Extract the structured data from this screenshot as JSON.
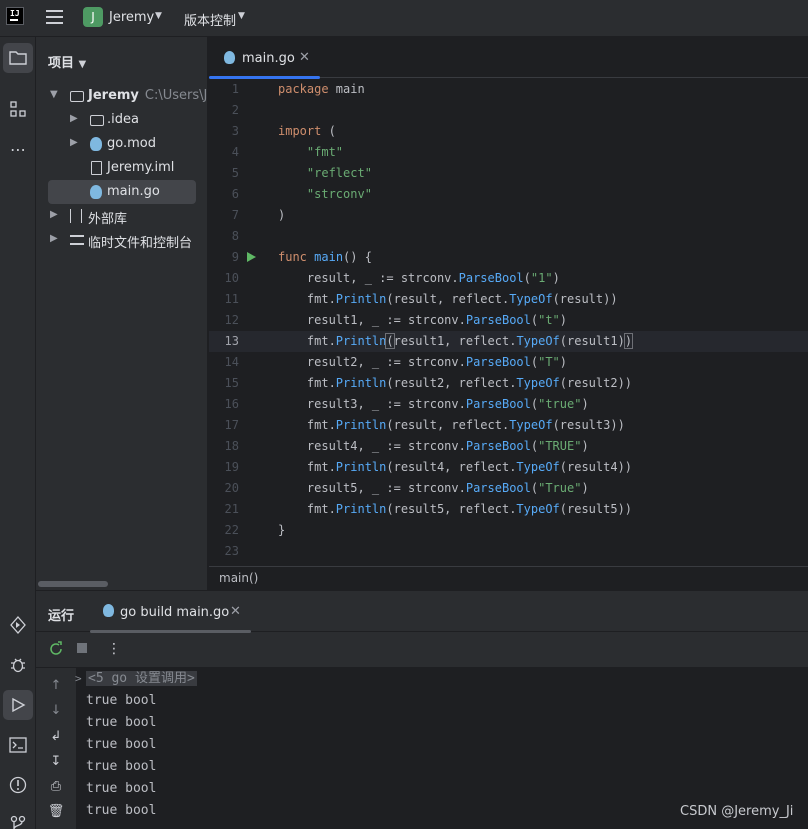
{
  "titlebar": {
    "logo_text": "IJ",
    "project_initial": "J",
    "project_name": "Jeremy",
    "vcs_label": "版本控制"
  },
  "project_panel": {
    "title": "项目",
    "tree": [
      {
        "label": "Jeremy",
        "path": "C:\\Users\\Jer",
        "icon": "folder-icon",
        "expanded": true,
        "depth": 0
      },
      {
        "label": ".idea",
        "icon": "folder-icon",
        "expanded": false,
        "depth": 1
      },
      {
        "label": "go.mod",
        "icon": "go-module-icon",
        "expanded": false,
        "depth": 1
      },
      {
        "label": "Jeremy.iml",
        "icon": "file-icon",
        "depth": 1
      },
      {
        "label": "main.go",
        "icon": "go-file-icon",
        "depth": 1,
        "selected": true
      },
      {
        "label": "外部库",
        "icon": "external-libraries-icon",
        "expanded": false,
        "depth": 0
      },
      {
        "label": "临时文件和控制台",
        "icon": "scratches-icon",
        "expanded": false,
        "depth": 0
      }
    ]
  },
  "editor": {
    "tab_label": "main.go",
    "current_line": 13,
    "lines": [
      {
        "n": "1",
        "html": "<span class=\"kw\">package</span> main"
      },
      {
        "n": "2",
        "html": ""
      },
      {
        "n": "3",
        "html": "<span class=\"kw\">import</span> ("
      },
      {
        "n": "4",
        "html": "    <span class=\"str\">\"fmt\"</span>"
      },
      {
        "n": "5",
        "html": "    <span class=\"str\">\"reflect\"</span>"
      },
      {
        "n": "6",
        "html": "    <span class=\"str\">\"strconv\"</span>"
      },
      {
        "n": "7",
        "html": ")"
      },
      {
        "n": "8",
        "html": ""
      },
      {
        "n": "9",
        "html": "<span class=\"kw\">func</span> <span class=\"fn\">main</span>() {"
      },
      {
        "n": "10",
        "html": "    result, _ := strconv.<span class=\"mcall\">ParseBool</span>(<span class=\"str\">\"1\"</span>)"
      },
      {
        "n": "11",
        "html": "    fmt.<span class=\"mcall\">Println</span>(result, reflect.<span class=\"mcall\">TypeOf</span>(result))"
      },
      {
        "n": "12",
        "html": "    result1, _ := strconv.<span class=\"mcall\">ParseBool</span>(<span class=\"str\">\"t\"</span>)"
      },
      {
        "n": "13",
        "html": "    fmt.<span class=\"mcall\">Println</span><span class=\"brace-hl\">(</span>result1, reflect.<span class=\"mcall\">TypeOf</span>(result1)<span class=\"brace-hl\">)</span>"
      },
      {
        "n": "14",
        "html": "    result2, _ := strconv.<span class=\"mcall\">ParseBool</span>(<span class=\"str\">\"T\"</span>)"
      },
      {
        "n": "15",
        "html": "    fmt.<span class=\"mcall\">Println</span>(result2, reflect.<span class=\"mcall\">TypeOf</span>(result2))"
      },
      {
        "n": "16",
        "html": "    result3, _ := strconv.<span class=\"mcall\">ParseBool</span>(<span class=\"str\">\"true\"</span>)"
      },
      {
        "n": "17",
        "html": "    fmt.<span class=\"mcall\">Println</span>(result, reflect.<span class=\"mcall\">TypeOf</span>(result3))"
      },
      {
        "n": "18",
        "html": "    result4, _ := strconv.<span class=\"mcall\">ParseBool</span>(<span class=\"str\">\"TRUE\"</span>)"
      },
      {
        "n": "19",
        "html": "    fmt.<span class=\"mcall\">Println</span>(result4, reflect.<span class=\"mcall\">TypeOf</span>(result4))"
      },
      {
        "n": "20",
        "html": "    result5, _ := strconv.<span class=\"mcall\">ParseBool</span>(<span class=\"str\">\"True\"</span>)"
      },
      {
        "n": "21",
        "html": "    fmt.<span class=\"mcall\">Println</span>(result5, reflect.<span class=\"mcall\">TypeOf</span>(result5))"
      },
      {
        "n": "22",
        "html": "}"
      },
      {
        "n": "23",
        "html": ""
      }
    ],
    "breadcrumb": "main()"
  },
  "run_panel": {
    "title": "运行",
    "tab_label": "go build main.go",
    "folded_line": "<5 go 设置调用>",
    "output": [
      "true bool",
      "true bool",
      "true bool",
      "true bool",
      "true bool",
      "true bool"
    ]
  },
  "watermark": "CSDN @Jeremy_Ji",
  "colors": {
    "accent": "#3574f0",
    "keyword": "#cf8e6d",
    "string": "#6aab73",
    "function": "#57aaf7",
    "run_green": "#5fb865"
  }
}
